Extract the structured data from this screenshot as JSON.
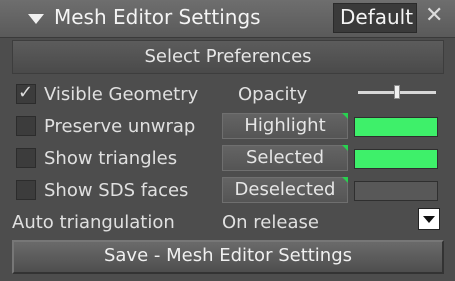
{
  "window": {
    "title": "Mesh Editor Settings",
    "preset": "Default",
    "collapse_icon": "triangle-down-icon",
    "close_icon": "close-icon"
  },
  "section": {
    "header": "Select Preferences"
  },
  "options": [
    {
      "label": "Visible Geometry",
      "checked": true
    },
    {
      "label": "Preserve unwrap",
      "checked": false
    },
    {
      "label": "Show triangles",
      "checked": false
    },
    {
      "label": "Show SDS faces",
      "checked": false
    }
  ],
  "opacity": {
    "label": "Opacity"
  },
  "color_modes": [
    {
      "label": "Highlight",
      "color": "#3ef06a"
    },
    {
      "label": "Selected",
      "color": "#3ef06a"
    },
    {
      "label": "Deselected",
      "color": "#585858"
    }
  ],
  "auto_triangulation": {
    "label": "Auto triangulation",
    "value": "On release"
  },
  "save_button": {
    "label": "Save - Mesh Editor Settings"
  }
}
